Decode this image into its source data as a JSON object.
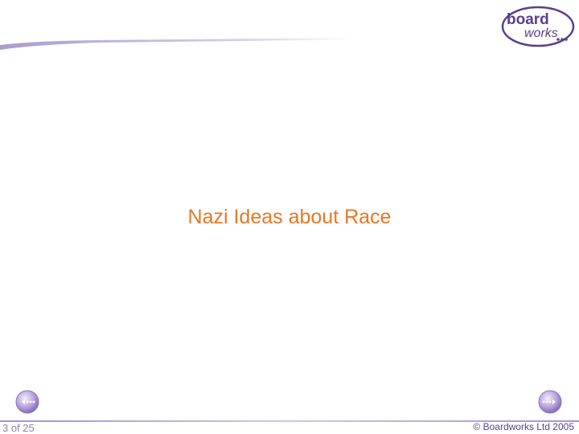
{
  "logo": {
    "line1": "board",
    "line2": "works"
  },
  "slide": {
    "title": "Nazi Ideas about Race"
  },
  "footer": {
    "page_counter": "3 of 25",
    "copyright": "© Boardworks Ltd 2005"
  },
  "icons": {
    "prev": "previous-arrow-icon",
    "next": "next-arrow-icon"
  },
  "colors": {
    "title": "#e87722",
    "brand_purple": "#5a3f8f",
    "rule_purple": "#b7aad6"
  }
}
